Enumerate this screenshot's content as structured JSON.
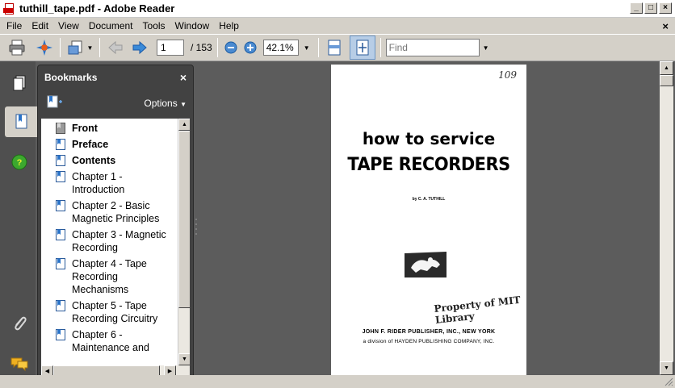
{
  "titlebar": {
    "title": "tuthill_tape.pdf - Adobe Reader",
    "minimize": "_",
    "maximize": "□",
    "close": "×"
  },
  "menu": {
    "items": [
      "File",
      "Edit",
      "View",
      "Document",
      "Tools",
      "Window",
      "Help"
    ],
    "close": "×"
  },
  "toolbar": {
    "current_page": "1",
    "page_total": "/ 153",
    "zoom": "42.1%",
    "find_placeholder": "Find"
  },
  "bookmarks": {
    "title": "Bookmarks",
    "close": "×",
    "options_label": "Options",
    "items": [
      {
        "label": "Front",
        "bold": true
      },
      {
        "label": "Preface",
        "bold": true
      },
      {
        "label": "Contents",
        "bold": true
      },
      {
        "label": "Chapter 1 - Introduction",
        "bold": false
      },
      {
        "label": "Chapter 2 - Basic Magnetic Principles",
        "bold": false
      },
      {
        "label": "Chapter 3 - Magnetic Recording",
        "bold": false
      },
      {
        "label": "Chapter 4 - Tape Recording Mechanisms",
        "bold": false
      },
      {
        "label": "Chapter 5 - Tape Recording Circuitry",
        "bold": false
      },
      {
        "label": "Chapter 6 - Maintenance and",
        "bold": false
      }
    ]
  },
  "document": {
    "handnote": "109",
    "title_line1": "how to service",
    "title_line2": "TAPE RECORDERS",
    "author": "by C. A. TUTHILL",
    "stamp": "Property of MIT Library",
    "publisher_line1": "JOHN F. RIDER PUBLISHER, INC., NEW YORK",
    "publisher_line2": "a division of HAYDEN PUBLISHING COMPANY, INC."
  }
}
